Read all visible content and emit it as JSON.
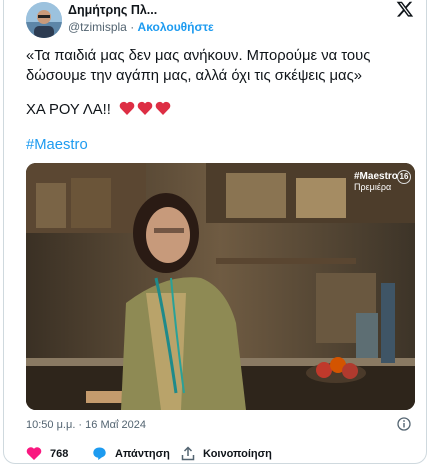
{
  "author": {
    "display_name": "Δημήτρης Πλ...",
    "handle": "@tzimispla",
    "separator": "·",
    "follow_label": "Ακολουθήστε"
  },
  "tweet": {
    "text_line1": "«Τα παιδιά μας δεν μας ανήκουν. Μπορούμε να τους δώσουμε την αγάπη μας, αλλά όχι τις σκέψεις μας»",
    "text_line2": "ΧΑ ΡΟΥ ΛΑ!!",
    "hearts": "❤️❤️❤️",
    "hashtag": "#Maestro"
  },
  "media_overlay": {
    "brand": "#Maestro",
    "subtitle": "Πρεμιέρα",
    "rating": "16"
  },
  "timestamp": "10:50 μ.μ. · 16 Μαΐ 2024",
  "actions": {
    "like_count": "768",
    "reply_label": "Απάντηση",
    "share_label": "Κοινοποίηση"
  },
  "colors": {
    "accent": "#1d9bf0",
    "like": "#f91880",
    "text": "#0f1419",
    "muted": "#536471"
  }
}
